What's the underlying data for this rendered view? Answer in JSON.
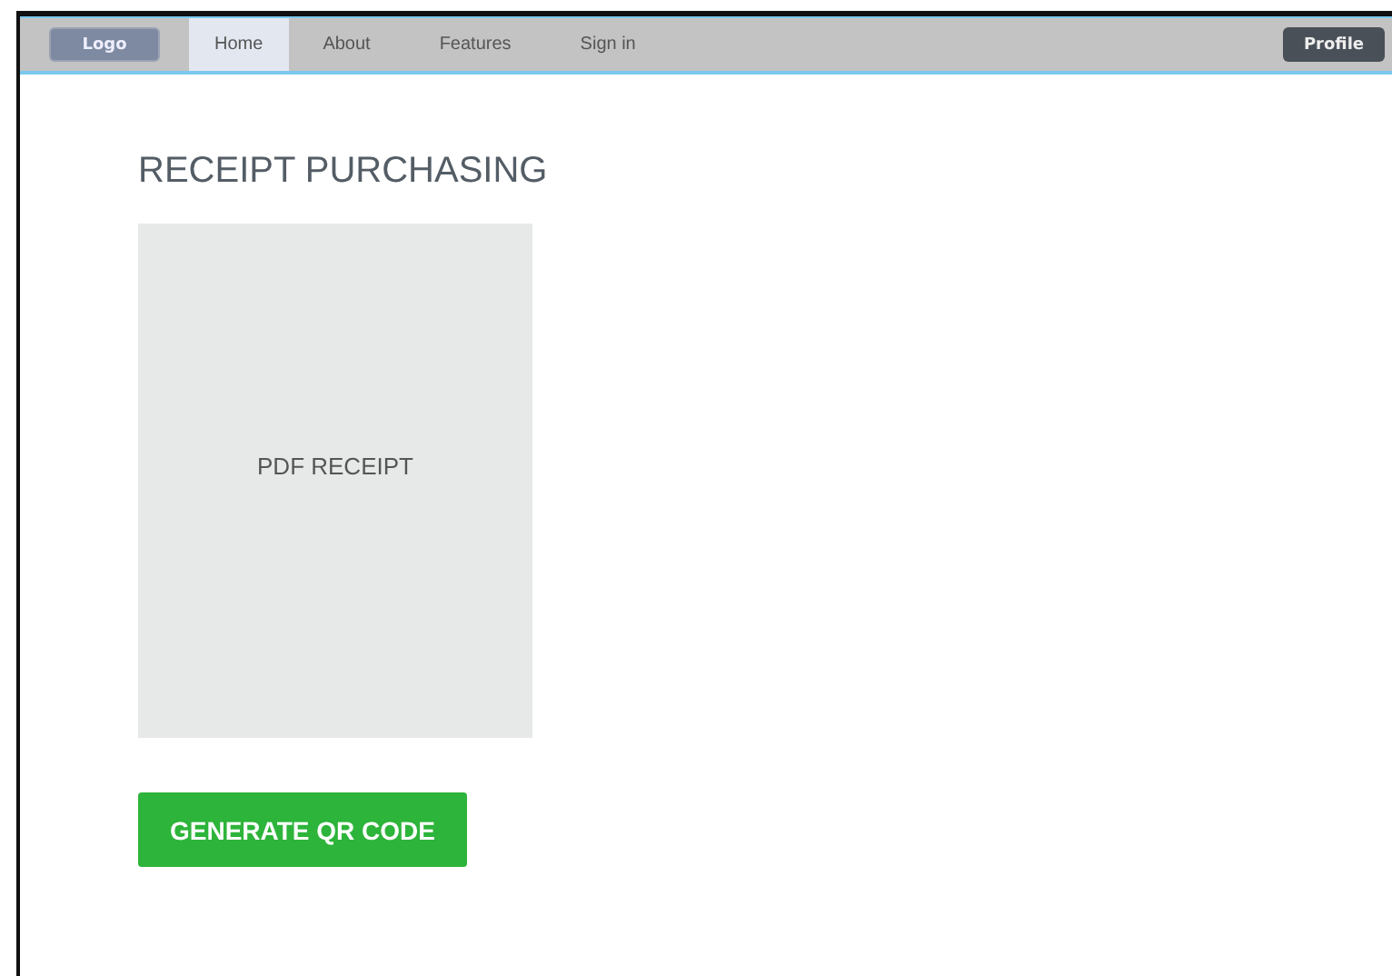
{
  "navbar": {
    "logo": "Logo",
    "tabs": [
      {
        "label": "Home",
        "selected": true
      },
      {
        "label": "About",
        "selected": false
      },
      {
        "label": "Features",
        "selected": false
      },
      {
        "label": "Sign in",
        "selected": false
      }
    ],
    "profile": "Profile"
  },
  "page": {
    "title": "RECEIPT PURCHASING",
    "receipt_placeholder": "PDF RECEIPT",
    "button": "GENERATE QR CODE"
  }
}
